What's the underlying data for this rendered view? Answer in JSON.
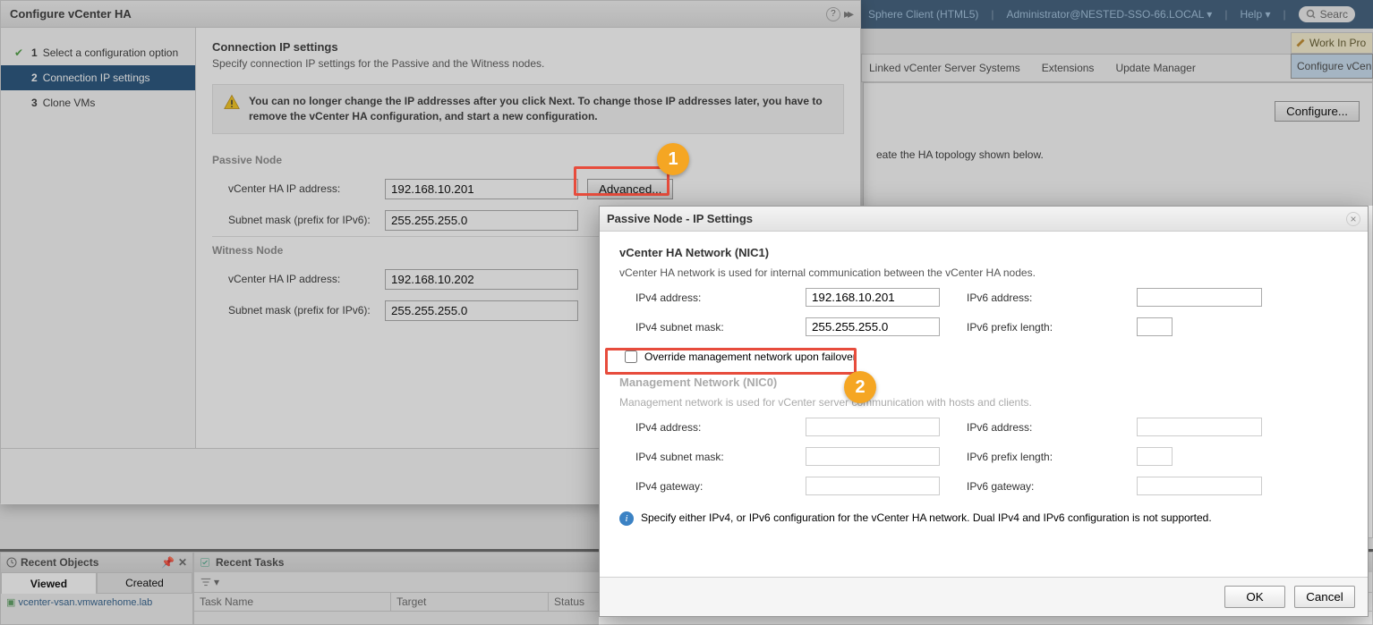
{
  "topbar": {
    "client": "Sphere Client (HTML5)",
    "user": "Administrator@NESTED-SSO-66.LOCAL",
    "help": "Help",
    "search": "Searc"
  },
  "wip": "Work In Pro",
  "bgtabs": {
    "t1": "Linked vCenter Server Systems",
    "t2": "Extensions",
    "t3": "Update Manager"
  },
  "configTabLabel": "Configure vCen",
  "configureBtn": "Configure...",
  "bgMsg": "eate the HA topology shown below.",
  "wizard": {
    "title": "Configure vCenter HA",
    "steps": {
      "s1": "Select a configuration option",
      "s2": "Connection IP settings",
      "s3": "Clone VMs",
      "n1": "1",
      "n2": "2",
      "n3": "3"
    },
    "heading": "Connection IP settings",
    "sub": "Specify connection IP settings for the Passive and the Witness nodes.",
    "warn": "You can no longer change the IP addresses after you click Next. To change those IP addresses later, you have to remove the vCenter HA configuration, and start a new configuration.",
    "passive": "Passive Node",
    "witness": "Witness Node",
    "haIpLabel": "vCenter HA IP address:",
    "subnetLabel": "Subnet mask (prefix for IPv6):",
    "advanced": "Advanced...",
    "passiveIp": "192.168.10.201",
    "passiveMask": "255.255.255.0",
    "witnessIp": "192.168.10.202",
    "witnessMask": "255.255.255.0"
  },
  "dlg": {
    "title": "Passive Node - IP Settings",
    "nic1": "vCenter HA Network (NIC1)",
    "nic1desc": "vCenter HA network is used for internal communication between the vCenter HA nodes.",
    "ipv4addr": "IPv4 address:",
    "ipv4mask": "IPv4 subnet mask:",
    "ipv6addr": "IPv6 address:",
    "ipv6prefix": "IPv6 prefix length:",
    "ipv4gw": "IPv4 gateway:",
    "ipv6gw": "IPv6 gateway:",
    "ip1": "192.168.10.201",
    "mask1": "255.255.255.0",
    "override": "Override management network upon failover",
    "nic0": "Management Network (NIC0)",
    "nic0desc": "Management network is used for vCenter server communication with hosts and clients.",
    "info": "Specify either IPv4, or IPv6 configuration for the vCenter HA network. Dual IPv4 and IPv6 configuration is not supported.",
    "ok": "OK",
    "cancel": "Cancel"
  },
  "annot": {
    "b1": "1",
    "b2": "2"
  },
  "recent": {
    "objects": "Recent Objects",
    "tasks": "Recent Tasks",
    "viewed": "Viewed",
    "created": "Created",
    "item": "vcenter-vsan.vmwarehome.lab",
    "taskName": "Task Name",
    "target": "Target",
    "status": "Status"
  }
}
